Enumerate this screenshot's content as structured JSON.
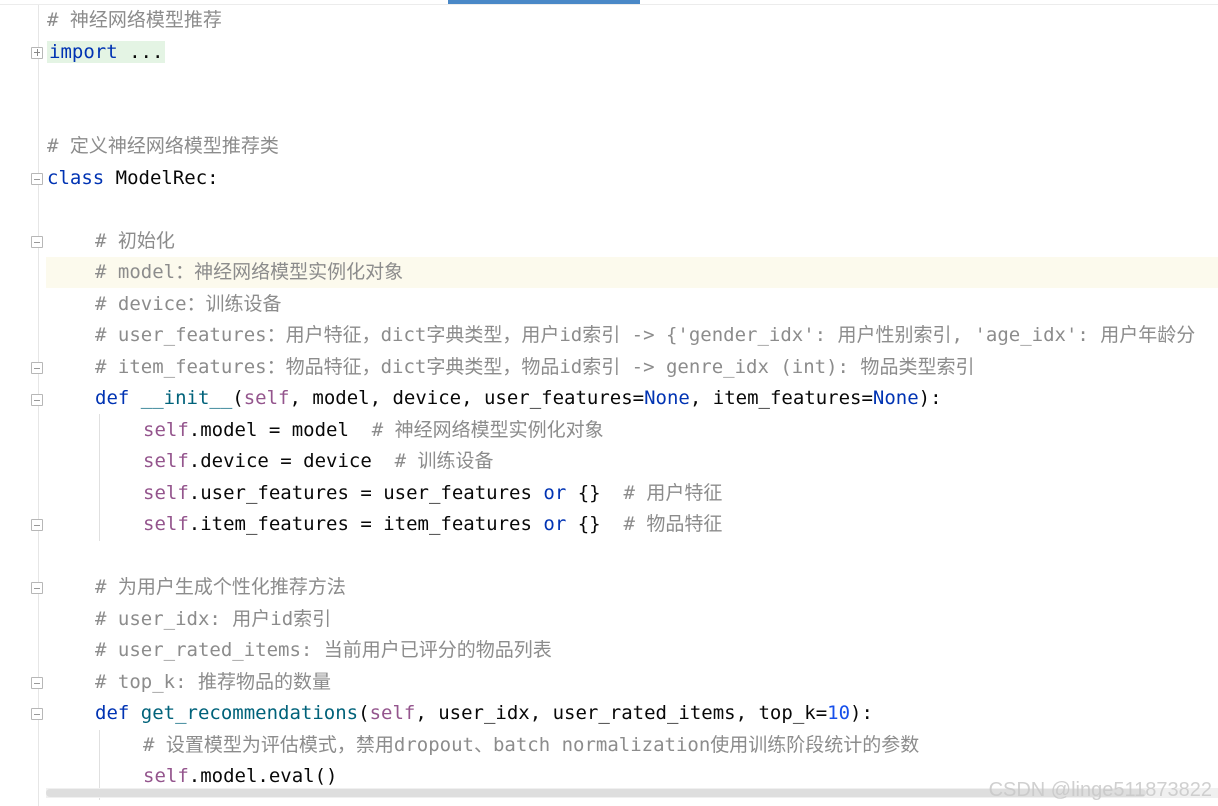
{
  "editor": {
    "lines": {
      "l1": "# 神经网络模型推荐",
      "l2_import": "import",
      "l2_rest": " ...",
      "l5": "# 定义神经网络模型推荐类",
      "l6_kw": "class",
      "l6_name": " ModelRec:",
      "l8": "# 初始化",
      "l9": "# model：神经网络模型实例化对象",
      "l10": "# device：训练设备",
      "l11": "# user_features：用户特征，dict字典类型，用户id索引 -> {'gender_idx': 用户性别索引, 'age_idx': 用户年龄分",
      "l12": "# item_features：物品特征，dict字典类型，物品id索引 -> genre_idx (int): 物品类型索引",
      "l13_def": "def",
      "l13_fn": " __init__",
      "l13_open": "(",
      "l13_self": "self",
      "l13_mid": ", model, device, user_features=",
      "l13_none1": "None",
      "l13_mid2": ", item_features=",
      "l13_none2": "None",
      "l13_close": "):",
      "l14_self": "self",
      "l14_code": ".model = model  ",
      "l14_cm": "# 神经网络模型实例化对象",
      "l15_self": "self",
      "l15_code": ".device = device  ",
      "l15_cm": "# 训练设备",
      "l16_self": "self",
      "l16_code": ".user_features = user_features ",
      "l16_or": "or",
      "l16_tail": " {}  ",
      "l16_cm": "# 用户特征",
      "l17_self": "self",
      "l17_code": ".item_features = item_features ",
      "l17_or": "or",
      "l17_tail": " {}  ",
      "l17_cm": "# 物品特征",
      "l19": "# 为用户生成个性化推荐方法",
      "l20": "# user_idx: 用户id索引",
      "l21": "# user_rated_items: 当前用户已评分的物品列表",
      "l22": "# top_k: 推荐物品的数量",
      "l23_def": "def",
      "l23_fn": " get_recommendations",
      "l23_open": "(",
      "l23_self": "self",
      "l23_mid": ", user_idx, user_rated_items, top_k=",
      "l23_num": "10",
      "l23_close": "):",
      "l24": "# 设置模型为评估模式，禁用dropout、batch normalization使用训练阶段统计的参数",
      "l25_self": "self",
      "l25_code": ".model.eval()"
    }
  },
  "watermark": "CSDN @linge511873822",
  "colors": {
    "keyword": "#0033b3",
    "function": "#00627a",
    "self": "#94558d",
    "number": "#1750eb",
    "comment": "#8c8c8c",
    "caret_line": "#fcfaed",
    "folded_bg": "#e4f4e4"
  }
}
